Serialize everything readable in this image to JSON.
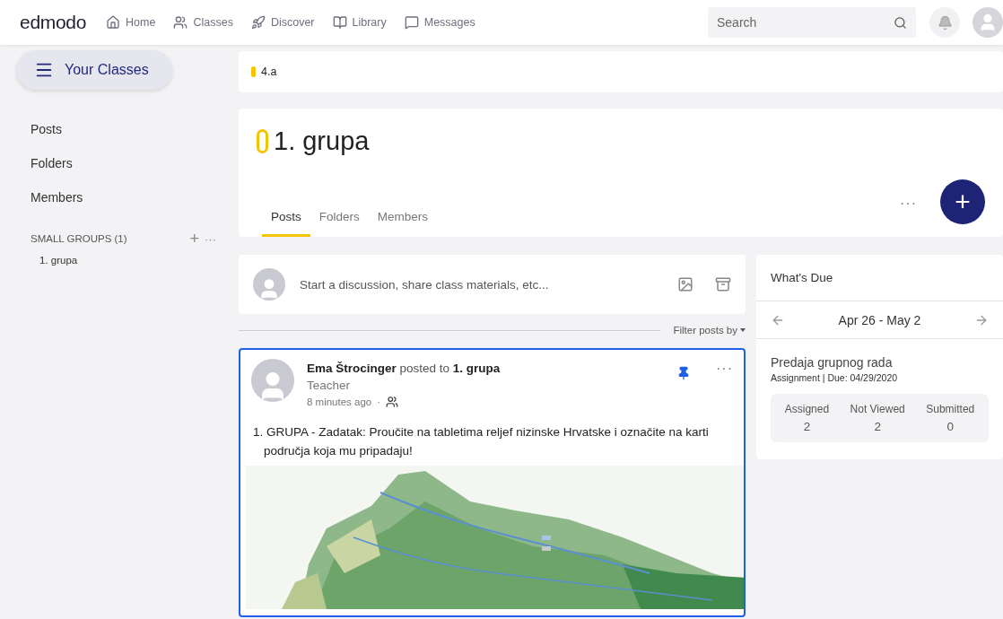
{
  "nav": {
    "logo": "edmodo",
    "links": [
      {
        "label": "Home"
      },
      {
        "label": "Classes"
      },
      {
        "label": "Discover"
      },
      {
        "label": "Library"
      },
      {
        "label": "Messages"
      }
    ],
    "search": {
      "placeholder": "Search"
    }
  },
  "sidebar": {
    "your_classes": "Your Classes",
    "items": [
      {
        "label": "Posts"
      },
      {
        "label": "Folders"
      },
      {
        "label": "Members"
      }
    ],
    "small_groups": {
      "label": "SMALL GROUPS (1)",
      "add": "+",
      "more": "···",
      "groups": [
        {
          "label": "1. grupa"
        }
      ]
    }
  },
  "breadcrumb": {
    "label": "4.a",
    "color": "#f5c400"
  },
  "group_header": {
    "title": "1. grupa",
    "color": "#f5c400",
    "more": "···",
    "add": "+",
    "tabs": [
      {
        "label": "Posts",
        "selected": true
      },
      {
        "label": "Folders",
        "selected": false
      },
      {
        "label": "Members",
        "selected": false
      }
    ]
  },
  "composer": {
    "placeholder": "Start a discussion, share class materials, etc..."
  },
  "filter": "Filter posts by",
  "post": {
    "author": "Ema Štrocinger",
    "posted_to": "posted to",
    "group": "1. grupa",
    "role": "Teacher",
    "time": "8 minutes ago",
    "separator": "·",
    "more": "···",
    "body": "1. GRUPA - Zadatak: Proučite na tabletima reljef nizinske Hrvatske i označite na karti područja koja mu pripadaju!"
  },
  "whats_due": {
    "title": "What's Due",
    "range": "Apr 26 - May 2",
    "item": {
      "title": "Predaja grupnog rada",
      "meta": "Assignment | Due: 04/29/2020",
      "stats": [
        {
          "label": "Assigned",
          "value": "2"
        },
        {
          "label": "Not Viewed",
          "value": "2"
        },
        {
          "label": "Submitted",
          "value": "0"
        }
      ]
    }
  }
}
